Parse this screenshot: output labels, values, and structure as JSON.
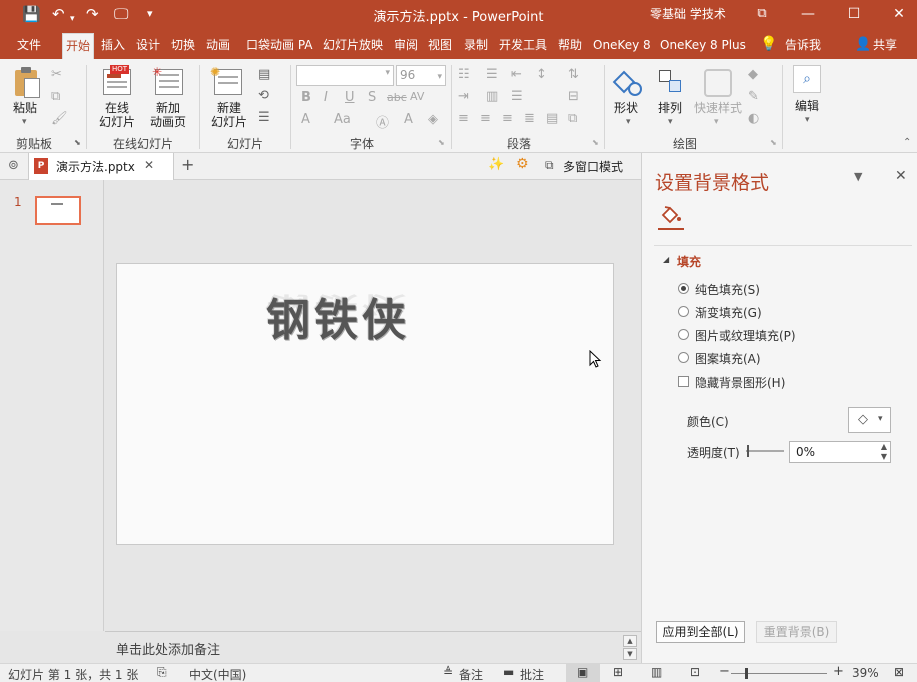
{
  "window": {
    "title": "演示方法.pptx  -  PowerPoint",
    "user": "零基础 学技术",
    "controls": {
      "restore": "⧉",
      "minimize": "—",
      "maximize": "☐",
      "close": "✕"
    }
  },
  "qat": {
    "save": "💾",
    "undo": "↶",
    "redo": "↷",
    "start": "🖵",
    "more": "▾"
  },
  "menu": {
    "tabs": [
      "文件",
      "开始",
      "插入",
      "设计",
      "切换",
      "动画",
      "口袋动画 PA",
      "幻灯片放映",
      "审阅",
      "视图",
      "录制",
      "开发工具",
      "帮助",
      "OneKey 8",
      "OneKey 8 Plus"
    ],
    "active": "开始",
    "tell_me": "告诉我",
    "share": "共享"
  },
  "ribbon": {
    "clipboard": {
      "paste": "粘贴",
      "group": "剪贴板"
    },
    "online_slides": {
      "online": "在线\n幻灯片",
      "new_anim": "新加\n动画页",
      "group": "在线幻灯片",
      "hot_badge": "HOT"
    },
    "slides": {
      "new_slide": "新建\n幻灯片",
      "group": "幻灯片"
    },
    "font": {
      "font_name": "",
      "font_size": "96",
      "group": "字体",
      "bold": "B",
      "italic": "I",
      "underline": "U",
      "shadow": "S",
      "strike": "abc",
      "spacing": "AV",
      "grow": "A",
      "case": "Aa"
    },
    "paragraph": {
      "group": "段落"
    },
    "drawing": {
      "shape": "形状",
      "arrange": "排列",
      "quick_style": "快速样式",
      "group": "绘图"
    },
    "editing": {
      "edit": "编辑"
    }
  },
  "doc_tab": {
    "name": "演示方法.pptx",
    "multi_window": "多窗口模式",
    "close": "✕",
    "add": "+"
  },
  "thumbnails": [
    {
      "number": "1"
    }
  ],
  "slide": {
    "text": "钢铁侠"
  },
  "notes": {
    "placeholder": "单击此处添加备注"
  },
  "format_panel": {
    "title": "设置背景格式",
    "section": "填充",
    "options": [
      "纯色填充(S)",
      "渐变填充(G)",
      "图片或纹理填充(P)",
      "图案填充(A)"
    ],
    "selected_option": "纯色填充(S)",
    "hide_bg": "隐藏背景图形(H)",
    "color_label": "颜色(C)",
    "transparency_label": "透明度(T)",
    "transparency_value": "0%",
    "apply_all": "应用到全部(L)",
    "reset": "重置背景(B)"
  },
  "status": {
    "slide_info": "幻灯片 第 1 张，共 1 张",
    "language": "中文(中国)",
    "notes": "备注",
    "comments": "批注",
    "zoom": "39%",
    "zoom_level": 0.39
  },
  "colors": {
    "accent": "#b7472a",
    "ribbon_bg": "#f3f3f3",
    "thumb_border": "#e8704e"
  }
}
